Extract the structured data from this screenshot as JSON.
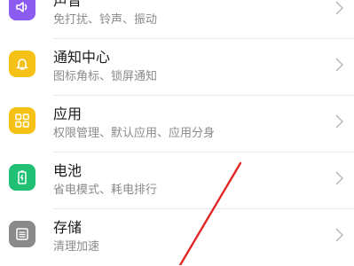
{
  "settings": {
    "items": [
      {
        "title": "声音",
        "subtitle": "免打扰、铃声、振动",
        "icon": "speaker-icon",
        "color": "#8c5cf2"
      },
      {
        "title": "通知中心",
        "subtitle": "图标角标、锁屏通知",
        "icon": "bell-icon",
        "color": "#f5c116"
      },
      {
        "title": "应用",
        "subtitle": "权限管理、默认应用、应用分身",
        "icon": "apps-grid-icon",
        "color": "#f5c116"
      },
      {
        "title": "电池",
        "subtitle": "省电模式、耗电排行",
        "icon": "battery-icon",
        "color": "#1fbf74"
      },
      {
        "title": "存储",
        "subtitle": "清理加速",
        "icon": "storage-icon",
        "color": "#8a8a8a"
      }
    ]
  },
  "colors": {
    "annotation_arrow": "#e32626",
    "divider": "#e8e8e8",
    "chevron": "#b5b5b5"
  }
}
